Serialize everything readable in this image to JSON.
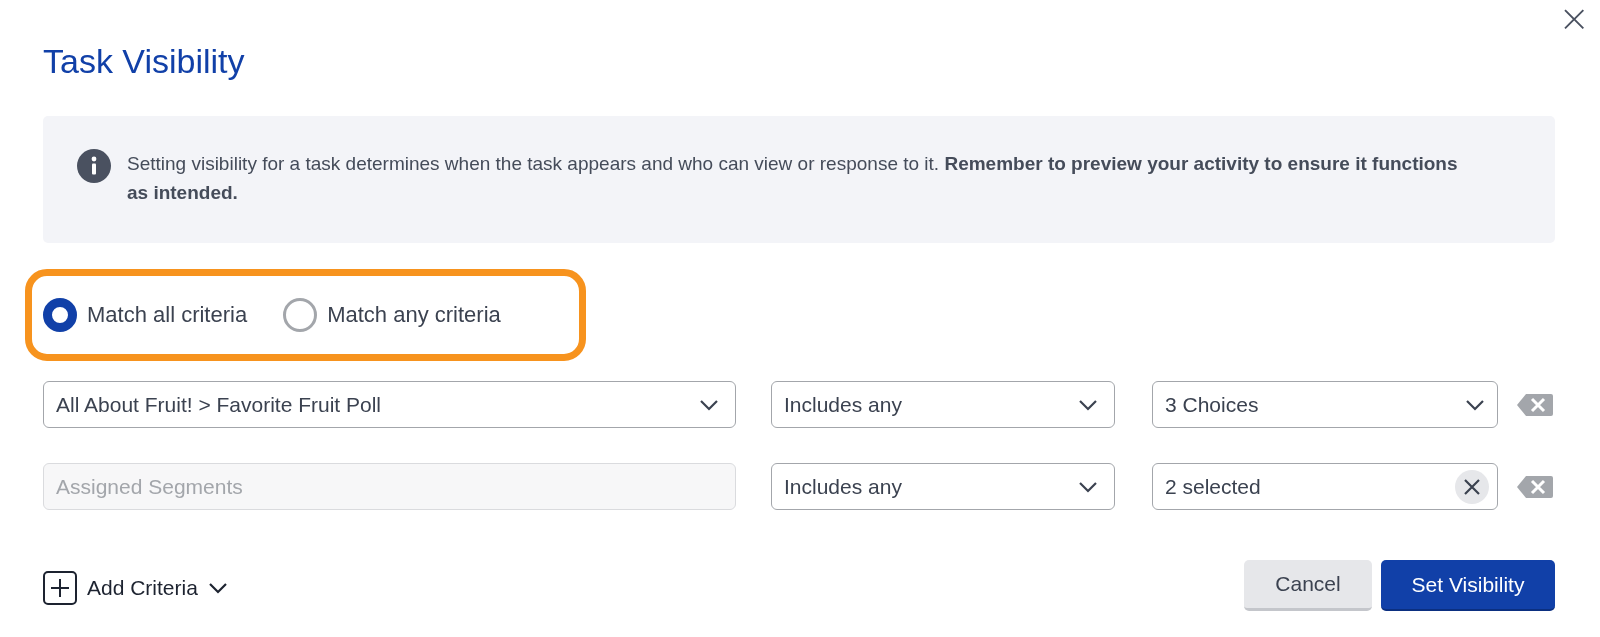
{
  "dialog": {
    "title": "Task Visibility",
    "close": "×"
  },
  "info": {
    "text": "Setting visibility for a task determines when the task appears and who can view or response to it. **Remember to preview your activity to ensure it functions as intended.**"
  },
  "match_options": [
    {
      "label": "Match all criteria",
      "selected": true
    },
    {
      "label": "Match any criteria",
      "selected": false
    }
  ],
  "criteria": [
    {
      "source": {
        "value": "All About Fruit! > Favorite Fruit Poll",
        "disabled": false
      },
      "operator": "Includes any",
      "target": {
        "kind": "select",
        "value": "3 Choices"
      }
    },
    {
      "source": {
        "placeholder": "Assigned Segments",
        "disabled": true
      },
      "operator": "Includes any",
      "target": {
        "kind": "clearable",
        "value": "2 selected"
      }
    }
  ],
  "add_criteria": "Add Criteria",
  "buttons": {
    "cancel": "Cancel",
    "submit": "Set Visibility"
  }
}
